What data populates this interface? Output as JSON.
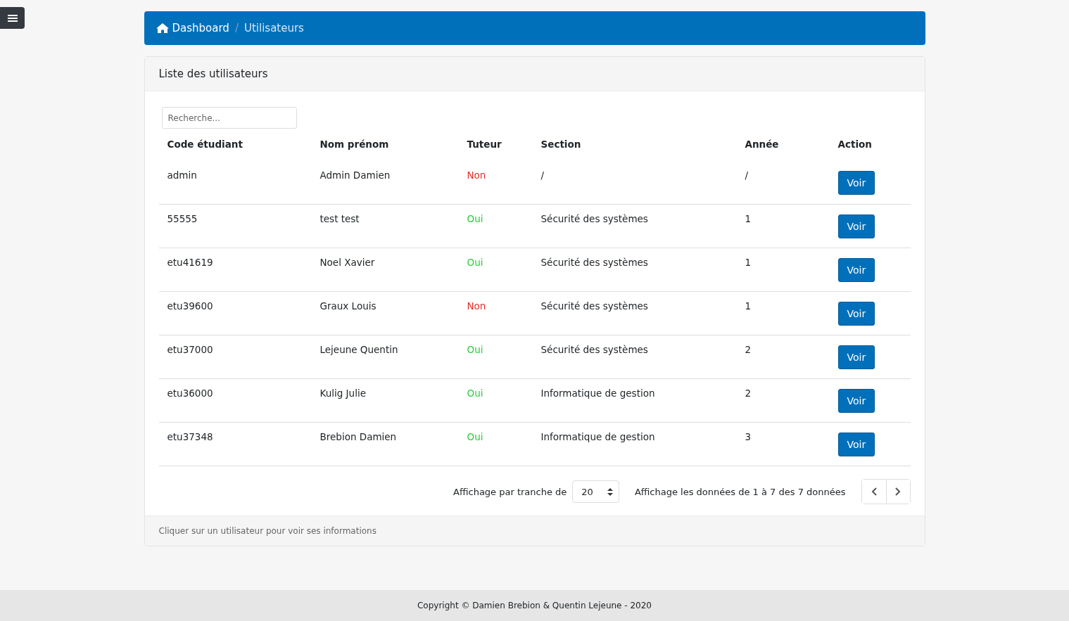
{
  "breadcrumb_separator": "/",
  "breadcrumb": [
    {
      "label": "Dashboard",
      "selected": false
    },
    {
      "label": "Utilisateurs",
      "selected": true
    }
  ],
  "card": {
    "title": "Liste des utilisateurs",
    "footer": "Cliquer sur un utilisateur pour voir ses informations"
  },
  "search": {
    "placeholder": "Recherche..."
  },
  "table": {
    "columns": [
      "Code étudiant",
      "Nom prénom",
      "Tuteur",
      "Section",
      "Année",
      "Action"
    ],
    "rows": [
      {
        "code": "admin",
        "name": "Admin Damien",
        "tutor": "Non",
        "is_tutor": false,
        "section": "/",
        "year": "/",
        "action": "Voir"
      },
      {
        "code": "55555",
        "name": "test test",
        "tutor": "Oui",
        "is_tutor": true,
        "section": "Sécurité des systèmes",
        "year": "1",
        "action": "Voir"
      },
      {
        "code": "etu41619",
        "name": "Noel Xavier",
        "tutor": "Oui",
        "is_tutor": true,
        "section": "Sécurité des systèmes",
        "year": "1",
        "action": "Voir"
      },
      {
        "code": "etu39600",
        "name": "Graux Louis",
        "tutor": "Non",
        "is_tutor": false,
        "section": "Sécurité des systèmes",
        "year": "1",
        "action": "Voir"
      },
      {
        "code": "etu37000",
        "name": "Lejeune Quentin",
        "tutor": "Oui",
        "is_tutor": true,
        "section": "Sécurité des systèmes",
        "year": "2",
        "action": "Voir"
      },
      {
        "code": "etu36000",
        "name": "Kulig Julie",
        "tutor": "Oui",
        "is_tutor": true,
        "section": "Informatique de gestion",
        "year": "2",
        "action": "Voir"
      },
      {
        "code": "etu37348",
        "name": "Brebion Damien",
        "tutor": "Oui",
        "is_tutor": true,
        "section": "Informatique de gestion",
        "year": "3",
        "action": "Voir"
      }
    ]
  },
  "pagination": {
    "per_page_label": "Affichage par tranche de",
    "per_page": "20",
    "info": "Affichage les données de 1 à 7 des 7 données"
  },
  "footer": {
    "text": "Copyright © Damien Brebion & Quentin Lejeune - 2020"
  }
}
